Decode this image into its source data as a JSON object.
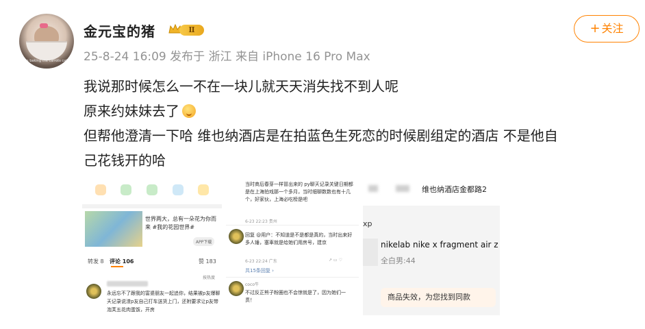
{
  "post": {
    "username": "金元宝的猪",
    "level": "Ⅱ",
    "avatar_caption": "I'm baking the carrots cake",
    "meta": "25-8-24 16:09  发布于 浙江  来自 iPhone 16 Pro Max",
    "follow_label": "关注",
    "text_lines": [
      "我说那时候怎么一不在一块儿就天天消失找不到人呢",
      "原来约妹妹去了",
      "但帮他澄清一下哈 维也纳酒店是在拍蓝色生死恋的时候剧组定的酒店 不是他自",
      "己花钱开的哈"
    ]
  },
  "image1": {
    "card_text": "世界两大，总有一朵花为你而来 #我的花园世界#",
    "app_label": "APP下载",
    "tabs": [
      "转发 8",
      "评论 106",
      "赞 183"
    ],
    "sort_label": "按热度",
    "comment_text": "永远忘不了跟我的富婆朋友一起追你，结果被p友爆聊天记录说渣p友自己打车送货上门，还附要求让p友带泡芙五花肉蛋饭，开房"
  },
  "image2": {
    "block1": "当时商后春芽一样冒出来的 py聊天记录关键日期都是在上海拍戏那一个多月，当时细聊数数也有十几个，好家伙，上海必吃榜是吧",
    "meta1": "6-23 22:23  贵州",
    "block2": "回复 @用户：不知道是不是都是真的，当时出来好多人锤，塞車就是给她们用房号，建京",
    "meta2": "6-23 22:24  广东",
    "more": "共15条回复 ›",
    "block3": "不过反正熊子粉圈也不会惊就是了，因为她们一贯！",
    "name3": "coco牛"
  },
  "image3": {
    "top_text": "维也纳酒店金都路2",
    "xp": "xp",
    "product_name": "nikelab nike x fragment air z",
    "product_sub": "全白男:44",
    "notice": "商品失效，为您找到同款"
  },
  "colors": {
    "accent": "#ff8200",
    "meta": "#939393",
    "text": "#222222"
  }
}
